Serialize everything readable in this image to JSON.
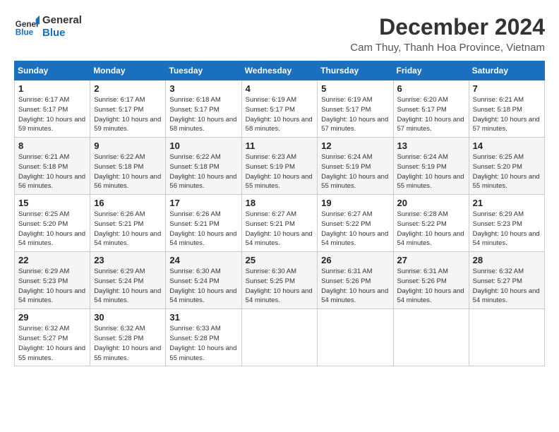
{
  "logo": {
    "text_general": "General",
    "text_blue": "Blue"
  },
  "header": {
    "month": "December 2024",
    "location": "Cam Thuy, Thanh Hoa Province, Vietnam"
  },
  "weekdays": [
    "Sunday",
    "Monday",
    "Tuesday",
    "Wednesday",
    "Thursday",
    "Friday",
    "Saturday"
  ],
  "weeks": [
    [
      {
        "day": "1",
        "sunrise": "6:17 AM",
        "sunset": "5:17 PM",
        "daylight": "10 hours and 59 minutes."
      },
      {
        "day": "2",
        "sunrise": "6:17 AM",
        "sunset": "5:17 PM",
        "daylight": "10 hours and 59 minutes."
      },
      {
        "day": "3",
        "sunrise": "6:18 AM",
        "sunset": "5:17 PM",
        "daylight": "10 hours and 58 minutes."
      },
      {
        "day": "4",
        "sunrise": "6:19 AM",
        "sunset": "5:17 PM",
        "daylight": "10 hours and 58 minutes."
      },
      {
        "day": "5",
        "sunrise": "6:19 AM",
        "sunset": "5:17 PM",
        "daylight": "10 hours and 57 minutes."
      },
      {
        "day": "6",
        "sunrise": "6:20 AM",
        "sunset": "5:17 PM",
        "daylight": "10 hours and 57 minutes."
      },
      {
        "day": "7",
        "sunrise": "6:21 AM",
        "sunset": "5:18 PM",
        "daylight": "10 hours and 57 minutes."
      }
    ],
    [
      {
        "day": "8",
        "sunrise": "6:21 AM",
        "sunset": "5:18 PM",
        "daylight": "10 hours and 56 minutes."
      },
      {
        "day": "9",
        "sunrise": "6:22 AM",
        "sunset": "5:18 PM",
        "daylight": "10 hours and 56 minutes."
      },
      {
        "day": "10",
        "sunrise": "6:22 AM",
        "sunset": "5:18 PM",
        "daylight": "10 hours and 56 minutes."
      },
      {
        "day": "11",
        "sunrise": "6:23 AM",
        "sunset": "5:19 PM",
        "daylight": "10 hours and 55 minutes."
      },
      {
        "day": "12",
        "sunrise": "6:24 AM",
        "sunset": "5:19 PM",
        "daylight": "10 hours and 55 minutes."
      },
      {
        "day": "13",
        "sunrise": "6:24 AM",
        "sunset": "5:19 PM",
        "daylight": "10 hours and 55 minutes."
      },
      {
        "day": "14",
        "sunrise": "6:25 AM",
        "sunset": "5:20 PM",
        "daylight": "10 hours and 55 minutes."
      }
    ],
    [
      {
        "day": "15",
        "sunrise": "6:25 AM",
        "sunset": "5:20 PM",
        "daylight": "10 hours and 54 minutes."
      },
      {
        "day": "16",
        "sunrise": "6:26 AM",
        "sunset": "5:21 PM",
        "daylight": "10 hours and 54 minutes."
      },
      {
        "day": "17",
        "sunrise": "6:26 AM",
        "sunset": "5:21 PM",
        "daylight": "10 hours and 54 minutes."
      },
      {
        "day": "18",
        "sunrise": "6:27 AM",
        "sunset": "5:21 PM",
        "daylight": "10 hours and 54 minutes."
      },
      {
        "day": "19",
        "sunrise": "6:27 AM",
        "sunset": "5:22 PM",
        "daylight": "10 hours and 54 minutes."
      },
      {
        "day": "20",
        "sunrise": "6:28 AM",
        "sunset": "5:22 PM",
        "daylight": "10 hours and 54 minutes."
      },
      {
        "day": "21",
        "sunrise": "6:29 AM",
        "sunset": "5:23 PM",
        "daylight": "10 hours and 54 minutes."
      }
    ],
    [
      {
        "day": "22",
        "sunrise": "6:29 AM",
        "sunset": "5:23 PM",
        "daylight": "10 hours and 54 minutes."
      },
      {
        "day": "23",
        "sunrise": "6:29 AM",
        "sunset": "5:24 PM",
        "daylight": "10 hours and 54 minutes."
      },
      {
        "day": "24",
        "sunrise": "6:30 AM",
        "sunset": "5:24 PM",
        "daylight": "10 hours and 54 minutes."
      },
      {
        "day": "25",
        "sunrise": "6:30 AM",
        "sunset": "5:25 PM",
        "daylight": "10 hours and 54 minutes."
      },
      {
        "day": "26",
        "sunrise": "6:31 AM",
        "sunset": "5:26 PM",
        "daylight": "10 hours and 54 minutes."
      },
      {
        "day": "27",
        "sunrise": "6:31 AM",
        "sunset": "5:26 PM",
        "daylight": "10 hours and 54 minutes."
      },
      {
        "day": "28",
        "sunrise": "6:32 AM",
        "sunset": "5:27 PM",
        "daylight": "10 hours and 54 minutes."
      }
    ],
    [
      {
        "day": "29",
        "sunrise": "6:32 AM",
        "sunset": "5:27 PM",
        "daylight": "10 hours and 55 minutes."
      },
      {
        "day": "30",
        "sunrise": "6:32 AM",
        "sunset": "5:28 PM",
        "daylight": "10 hours and 55 minutes."
      },
      {
        "day": "31",
        "sunrise": "6:33 AM",
        "sunset": "5:28 PM",
        "daylight": "10 hours and 55 minutes."
      },
      null,
      null,
      null,
      null
    ]
  ]
}
